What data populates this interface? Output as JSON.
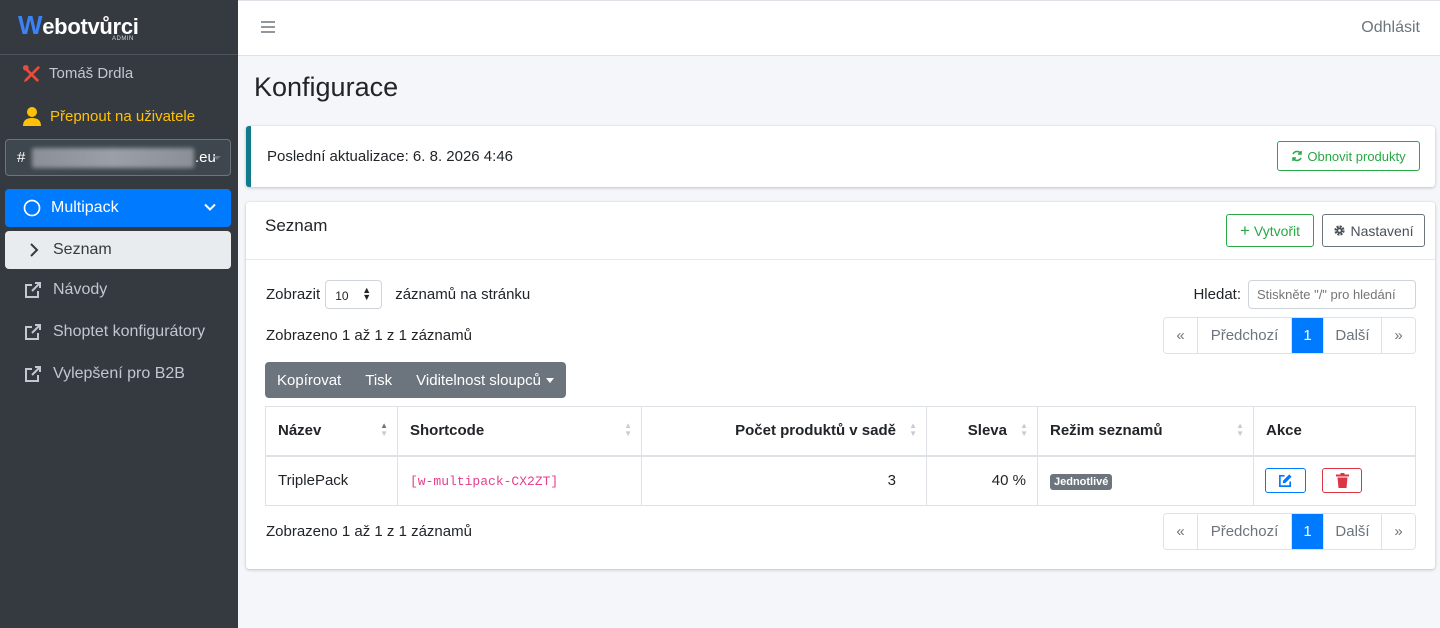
{
  "brand": {
    "name_initial": "W",
    "name_rest": "ebotvůrci",
    "tag": "ADMIN"
  },
  "sidebar": {
    "user_name": "Tomáš Drdla",
    "switch_user": "Přepnout na uživatele",
    "domain_prefix": "#",
    "domain_suffix": ".eu",
    "active_item": "Multipack",
    "sub_item": "Seznam",
    "links": [
      "Návody",
      "Shoptet konfigurátory",
      "Vylepšení pro B2B"
    ]
  },
  "topbar": {
    "logout": "Odhlásit"
  },
  "page": {
    "title": "Konfigurace"
  },
  "update": {
    "text": "Poslední aktualizace: 6. 8. 2026 4:46",
    "refresh_label": "Obnovit produkty"
  },
  "list": {
    "title": "Seznam",
    "create_label": "Vytvořit",
    "settings_label": "Nastavení",
    "show_label": "Zobrazit",
    "page_length": "10",
    "per_page_label": "záznamů na stránku",
    "search_label": "Hledat:",
    "search_placeholder": "Stiskněte \"/\" pro hledání",
    "info": "Zobrazeno 1 až 1 z 1 záznamů",
    "pager": {
      "first": "«",
      "prev": "Předchozí",
      "current": "1",
      "next": "Další",
      "last": "»"
    },
    "buttons": {
      "copy": "Kopírovat",
      "print": "Tisk",
      "columns": "Viditelnost sloupců"
    },
    "columns": [
      "Název",
      "Shortcode",
      "Počet produktů v sadě",
      "Sleva",
      "Režim seznamů",
      "Akce"
    ],
    "rows": [
      {
        "name": "TriplePack",
        "shortcode": "[w-multipack-CX2ZT]",
        "count": "3",
        "discount": "40 %",
        "mode": "Jednotlivé"
      }
    ]
  },
  "colors": {
    "sidebar": "#343a40",
    "primary": "#007bff",
    "success": "#28a745",
    "danger": "#dc3545",
    "info_border": "#117a8b",
    "code": "#e83e8c",
    "warning": "#ffc107"
  }
}
